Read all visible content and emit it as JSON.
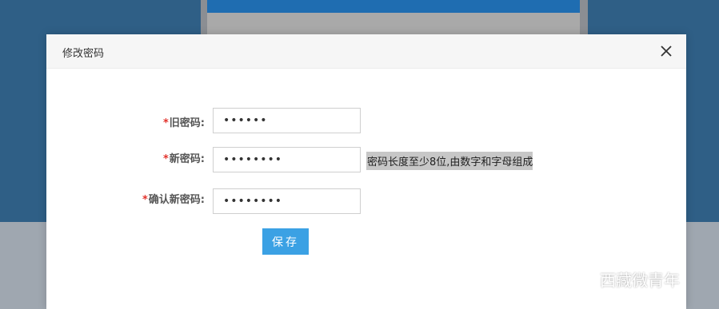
{
  "modal": {
    "title": "修改密码",
    "fields": [
      {
        "required_mark": "*",
        "label": "旧密码:",
        "value": "••••••"
      },
      {
        "required_mark": "*",
        "label": "新密码:",
        "value": "••••••••"
      },
      {
        "required_mark": "*",
        "label": "确认新密码:",
        "value": "••••••••"
      }
    ],
    "password_hint": "密码长度至少8位,由数字和字母组成",
    "save_label": "保存"
  },
  "watermark": {
    "text": "西藏微青年",
    "icon": "wechat-icon"
  },
  "colors": {
    "accent": "#3ba1e4",
    "required": "#e2322b",
    "hint_bg": "#c7c7c7"
  }
}
